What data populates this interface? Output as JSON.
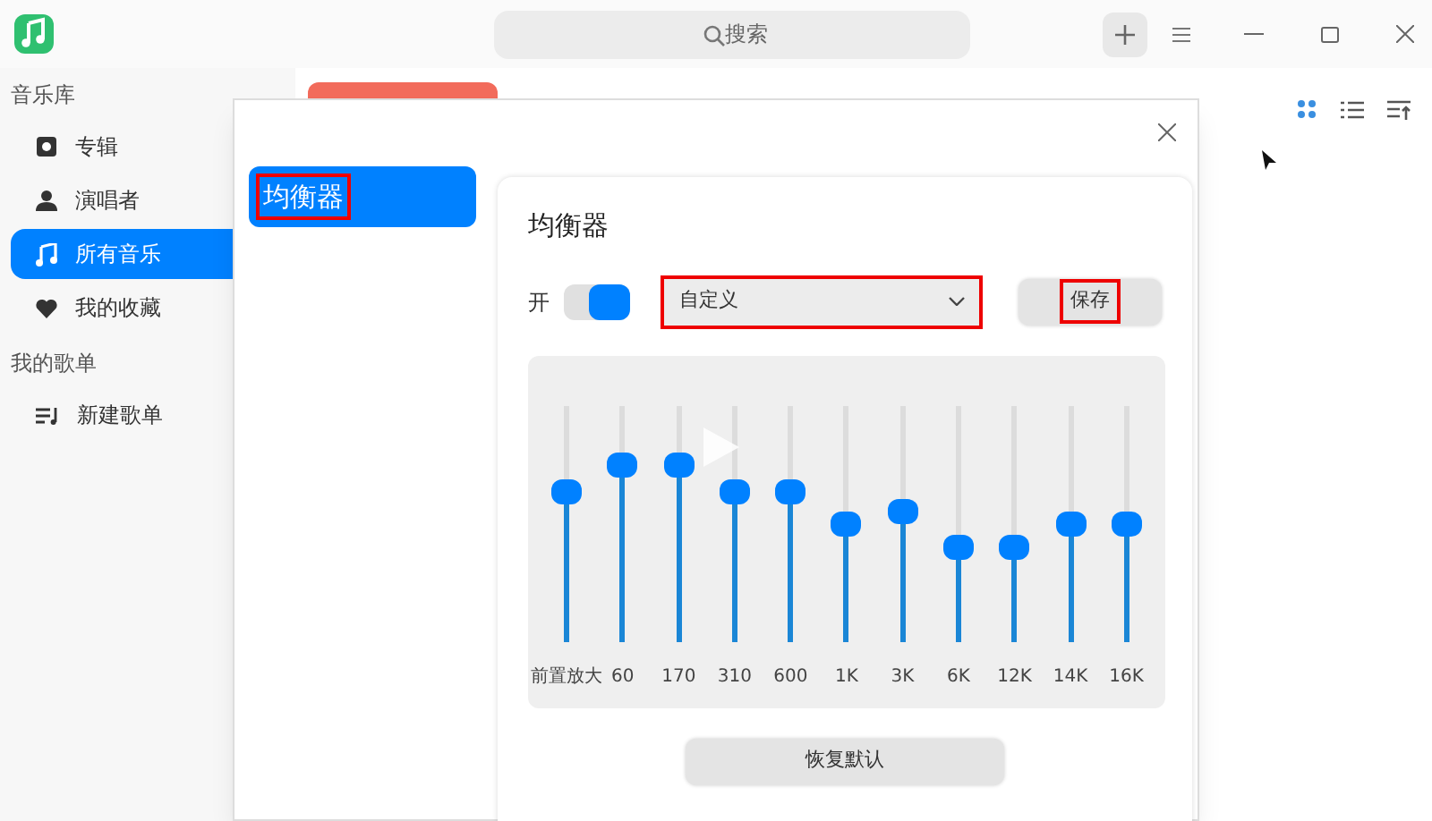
{
  "search": {
    "placeholder": "搜索"
  },
  "sidebar": {
    "sections": [
      {
        "title": "音乐库",
        "items": [
          {
            "label": "专辑",
            "selected": false
          },
          {
            "label": "演唱者",
            "selected": false
          },
          {
            "label": "所有音乐",
            "selected": true
          },
          {
            "label": "我的收藏",
            "selected": false
          }
        ]
      },
      {
        "title": "我的歌单",
        "items": [
          {
            "label": "新建歌单",
            "selected": false
          }
        ]
      }
    ]
  },
  "view_modes": [
    {
      "selected": true
    },
    {
      "selected": false
    },
    {
      "selected": false
    }
  ],
  "dialog": {
    "nav": [
      {
        "label": "均衡器",
        "selected": true,
        "highlighted": true
      }
    ],
    "title": "均衡器",
    "switch": {
      "label": "开",
      "on": true
    },
    "preset": {
      "value": "自定义",
      "highlighted": true
    },
    "save_button": {
      "label": "保存",
      "highlighted": true
    },
    "bands": [
      {
        "label": "前置放大",
        "level": 0.63
      },
      {
        "label": "60",
        "level": 0.75
      },
      {
        "label": "170",
        "level": 0.75
      },
      {
        "label": "310",
        "level": 0.63
      },
      {
        "label": "600",
        "level": 0.63
      },
      {
        "label": "1K",
        "level": 0.5
      },
      {
        "label": "3K",
        "level": 0.55
      },
      {
        "label": "6K",
        "level": 0.4
      },
      {
        "label": "12K",
        "level": 0.4
      },
      {
        "label": "14K",
        "level": 0.5
      },
      {
        "label": "16K",
        "level": 0.5
      }
    ],
    "reset_button": "恢复默认"
  }
}
